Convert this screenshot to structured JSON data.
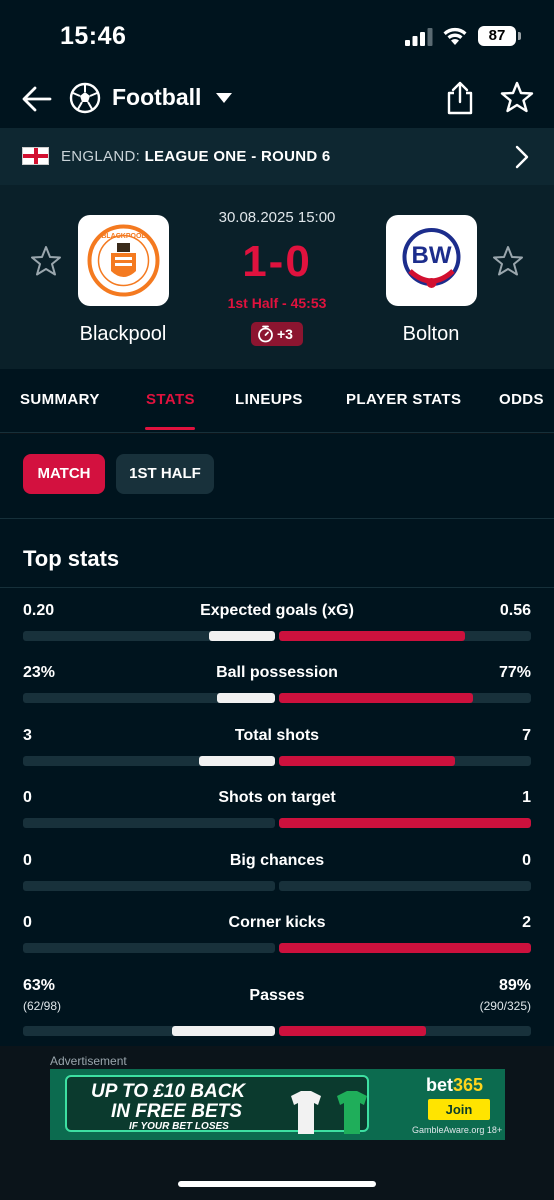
{
  "status_bar": {
    "time": "15:46",
    "battery": "87"
  },
  "nav": {
    "title": "Football",
    "back_icon": "arrow-left-icon",
    "sport_icon": "football-icon",
    "share_icon": "share-icon",
    "favorite_icon": "star-outline-icon"
  },
  "league": {
    "country": "ENGLAND: ",
    "name": "LEAGUE ONE - ROUND 6",
    "flag_icon": "england-flag-icon"
  },
  "match": {
    "date": "30.08.2025 15:00",
    "score": "1-0",
    "status": "1st Half - 45:53",
    "added_time": "+3",
    "home": {
      "name": "Blackpool",
      "badge_color": "#f47a20"
    },
    "away": {
      "name": "Bolton",
      "badge_color": "#1c2d8c"
    }
  },
  "tabs": [
    {
      "label": "SUMMARY"
    },
    {
      "label": "STATS"
    },
    {
      "label": "LINEUPS"
    },
    {
      "label": "PLAYER STATS"
    },
    {
      "label": "ODDS"
    }
  ],
  "period_chips": {
    "match": "MATCH",
    "first_half": "1ST HALF"
  },
  "section_title": "Top stats",
  "stats": [
    {
      "name": "Expected goals (xG)",
      "home": "0.20",
      "away": "0.56",
      "home_share": 0.263,
      "away_share": 0.737
    },
    {
      "name": "Ball possession",
      "home": "23%",
      "away": "77%",
      "home_share": 0.23,
      "away_share": 0.77
    },
    {
      "name": "Total shots",
      "home": "3",
      "away": "7",
      "home_share": 0.3,
      "away_share": 0.7
    },
    {
      "name": "Shots on target",
      "home": "0",
      "away": "1",
      "home_share": 0.0,
      "away_share": 1.0
    },
    {
      "name": "Big chances",
      "home": "0",
      "away": "0",
      "home_share": 0.0,
      "away_share": 0.0
    },
    {
      "name": "Corner kicks",
      "home": "0",
      "away": "2",
      "home_share": 0.0,
      "away_share": 1.0
    },
    {
      "name": "Passes",
      "home": "63%",
      "away": "89%",
      "home_sub": "(62/98)",
      "away_sub": "(290/325)",
      "home_share": 0.41,
      "away_share": 0.585
    }
  ],
  "ad": {
    "label": "Advertisement",
    "headline_1": "UP TO £10 BACK",
    "headline_2": "IN FREE BETS",
    "small": "IF YOUR BET LOSES",
    "brand_a": "bet",
    "brand_b": "365",
    "join": "Join",
    "gamble": "GambleAware.org 18+"
  },
  "colors": {
    "accent": "#e0123e",
    "background": "#00141e",
    "panel": "#0a2029",
    "bar_track": "#18313b"
  }
}
